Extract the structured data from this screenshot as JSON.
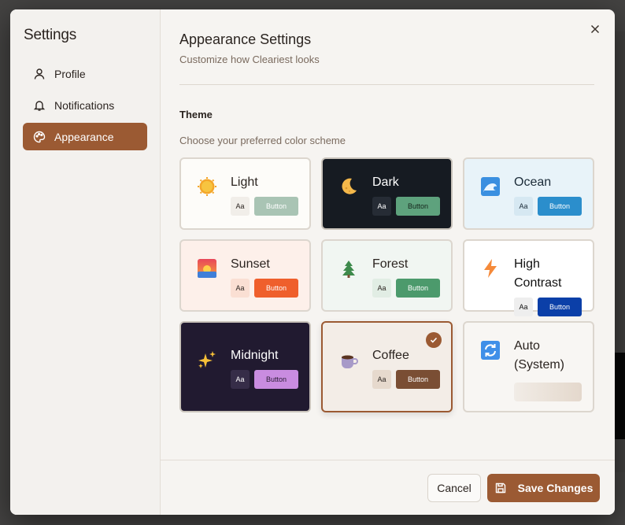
{
  "sidebar": {
    "title": "Settings",
    "items": [
      {
        "label": "Profile",
        "icon": "user-icon"
      },
      {
        "label": "Notifications",
        "icon": "bell-icon"
      },
      {
        "label": "Appearance",
        "icon": "palette-icon",
        "active": true
      }
    ]
  },
  "header": {
    "title": "Appearance Settings",
    "subtitle": "Customize how Cleariest looks"
  },
  "theme": {
    "title": "Theme",
    "description": "Choose your preferred color scheme",
    "selected": "Coffee",
    "options": [
      {
        "name": "Light",
        "icon": "sun-icon",
        "preview_text": "Aa",
        "preview_button": "Button",
        "bg": "#fdfcf9",
        "text": "#2b2420",
        "aa_bg": "#f1eee9",
        "aa_text": "#2b2420",
        "btn_bg": "#a9c4b4",
        "btn_text": "#ffffff"
      },
      {
        "name": "Dark",
        "icon": "moon-icon",
        "preview_text": "Aa",
        "preview_button": "Button",
        "bg": "#161b22",
        "text": "#ffffff",
        "aa_bg": "#262c35",
        "aa_text": "#ffffff",
        "btn_bg": "#5ea27d",
        "btn_text": "#15251b"
      },
      {
        "name": "Ocean",
        "icon": "wave-icon",
        "preview_text": "Aa",
        "preview_button": "Button",
        "bg": "#e8f3f9",
        "text": "#1b2b38",
        "aa_bg": "#d6e8f2",
        "aa_text": "#1b2b38",
        "btn_bg": "#2b8ecc",
        "btn_text": "#ffffff"
      },
      {
        "name": "Sunset",
        "icon": "sunset-icon",
        "preview_text": "Aa",
        "preview_button": "Button",
        "bg": "#fdf0ea",
        "text": "#2b2420",
        "aa_bg": "#fadfd3",
        "aa_text": "#2b2420",
        "btn_bg": "#ef5f2c",
        "btn_text": "#ffffff"
      },
      {
        "name": "Forest",
        "icon": "tree-icon",
        "preview_text": "Aa",
        "preview_button": "Button",
        "bg": "#f1f6f2",
        "text": "#2b2420",
        "aa_bg": "#e1ede4",
        "aa_text": "#2b2420",
        "btn_bg": "#4c9a6c",
        "btn_text": "#ffffff"
      },
      {
        "name": "High Contrast",
        "icon": "lightning-icon",
        "preview_text": "Aa",
        "preview_button": "Button",
        "bg": "#ffffff",
        "text": "#111111",
        "aa_bg": "#eeeeee",
        "aa_text": "#111111",
        "btn_bg": "#0b3fa8",
        "btn_text": "#ffffff"
      },
      {
        "name": "Midnight",
        "icon": "sparkles-icon",
        "preview_text": "Aa",
        "preview_button": "Button",
        "bg": "#211a30",
        "text": "#ffffff",
        "aa_bg": "#362d48",
        "aa_text": "#ffffff",
        "btn_bg": "#c98ce0",
        "btn_text": "#2a1b34"
      },
      {
        "name": "Coffee",
        "icon": "coffee-icon",
        "preview_text": "Aa",
        "preview_button": "Button",
        "bg": "#f3ede7",
        "text": "#2b2420",
        "aa_bg": "#e6d9cd",
        "aa_text": "#2b2420",
        "btn_bg": "#7a4e34",
        "btn_text": "#ffffff"
      },
      {
        "name": "Auto (System)",
        "icon": "sync-icon",
        "bg": "#f8f6f3",
        "text": "#2b2420"
      }
    ]
  },
  "footer": {
    "cancel_label": "Cancel",
    "save_label": "Save Changes"
  },
  "colors": {
    "accent": "#9b5a33",
    "dialog_bg": "#f6f4f1"
  }
}
